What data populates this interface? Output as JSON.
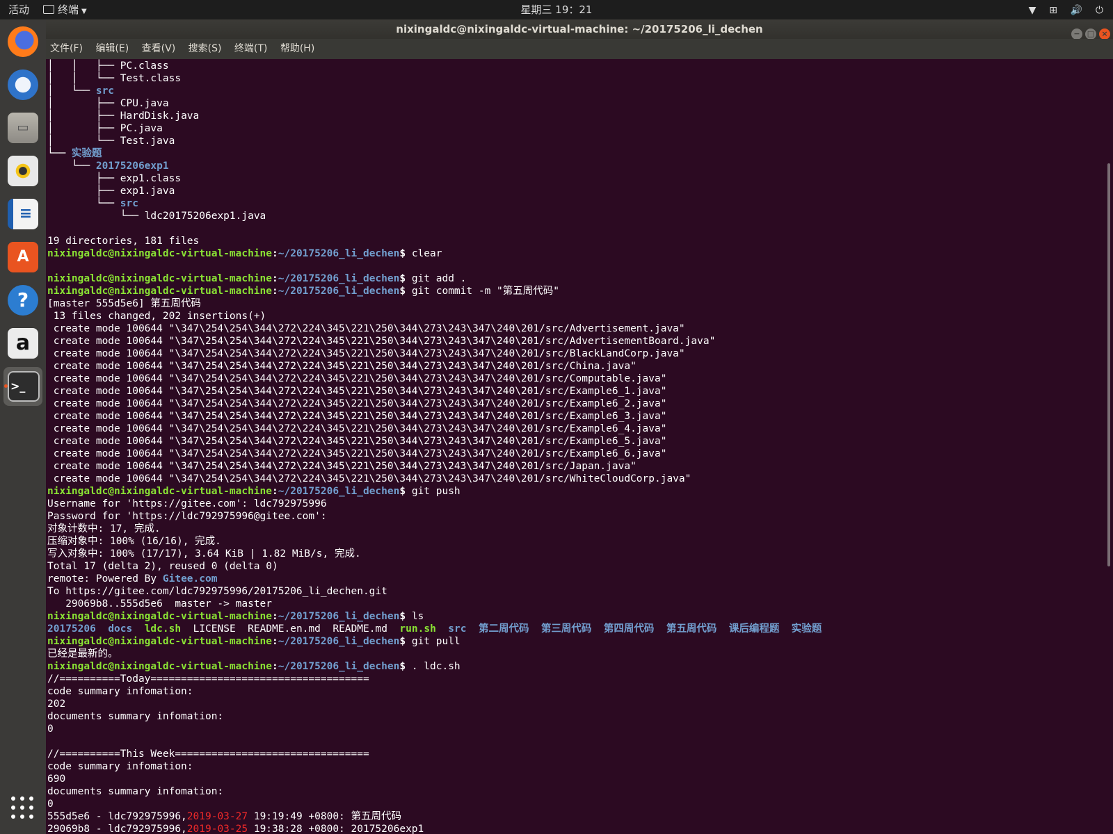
{
  "topbar": {
    "activities": "活动",
    "app_name": "终端",
    "clock": "星期三 19：21",
    "icons": [
      "chevron-down-icon",
      "network-icon",
      "volume-icon",
      "power-icon"
    ]
  },
  "dock": {
    "apps": [
      "firefox-icon",
      "thunderbird-icon",
      "files-icon",
      "rhythmbox-icon",
      "libreoffice-writer-icon",
      "software-center-icon",
      "help-icon",
      "amazon-icon",
      "terminal-icon"
    ]
  },
  "window": {
    "title": "nixingaldc@nixingaldc-virtual-machine: ~/20175206_li_dechen",
    "menus": [
      "文件(F)",
      "编辑(E)",
      "查看(V)",
      "搜索(S)",
      "终端(T)",
      "帮助(H)"
    ]
  },
  "prompt": {
    "user": "nixingaldc@nixingaldc-virtual-machine",
    "path": "~/20175206_li_dechen",
    "sep": ":",
    "dollar": "$"
  },
  "terminal": {
    "tree": [
      {
        "prefix": "│   │   ├── ",
        "name": "PC.class",
        "type": "file"
      },
      {
        "prefix": "│   │   └── ",
        "name": "Test.class",
        "type": "file"
      },
      {
        "prefix": "│   └── ",
        "name": "src",
        "type": "dir"
      },
      {
        "prefix": "│       ├── ",
        "name": "CPU.java",
        "type": "file"
      },
      {
        "prefix": "│       ├── ",
        "name": "HardDisk.java",
        "type": "file"
      },
      {
        "prefix": "│       ├── ",
        "name": "PC.java",
        "type": "file"
      },
      {
        "prefix": "│       └── ",
        "name": "Test.java",
        "type": "file"
      },
      {
        "prefix": "└── ",
        "name": "实验题",
        "type": "dir"
      },
      {
        "prefix": "    └── ",
        "name": "20175206exp1",
        "type": "dir"
      },
      {
        "prefix": "        ├── ",
        "name": "exp1.class",
        "type": "file"
      },
      {
        "prefix": "        ├── ",
        "name": "exp1.java",
        "type": "file"
      },
      {
        "prefix": "        └── ",
        "name": "src",
        "type": "dir"
      },
      {
        "prefix": "            └── ",
        "name": "ldc20175206exp1.java",
        "type": "file"
      }
    ],
    "tree_summary": "19 directories, 181 files",
    "cmd_clear": "clear",
    "cmd_add": "git add .",
    "cmd_commit": "git commit -m \"第五周代码\"",
    "commit_header": "[master 555d5e6] 第五周代码",
    "commit_stats": " 13 files changed, 202 insertions(+)",
    "create_prefix": " create mode 100644 \"\\347\\254\\254\\344\\272\\224\\345\\221\\250\\344\\273\\243\\347\\240\\201/src/",
    "created_files": [
      "Advertisement.java",
      "AdvertisementBoard.java",
      "BlackLandCorp.java",
      "China.java",
      "Computable.java",
      "Example6_1.java",
      "Example6_2.java",
      "Example6_3.java",
      "Example6_4.java",
      "Example6_5.java",
      "Example6_6.java",
      "Japan.java",
      "WhiteCloudCorp.java"
    ],
    "cmd_push": "git push",
    "push_output": [
      "Username for 'https://gitee.com': ldc792975996",
      "Password for 'https://ldc792975996@gitee.com':",
      "对象计数中: 17, 完成.",
      "压缩对象中: 100% (16/16), 完成.",
      "写入对象中: 100% (17/17), 3.64 KiB | 1.82 MiB/s, 完成.",
      "Total 17 (delta 2), reused 0 (delta 0)"
    ],
    "remote_prefix": "remote: Powered By ",
    "remote_link": "Gitee.com",
    "push_to": "To https://gitee.com/ldc792975996/20175206_li_dechen.git",
    "push_refs": "   29069b8..555d5e6  master -> master",
    "cmd_ls": "ls",
    "ls_items": [
      {
        "name": "20175206",
        "color": "blue"
      },
      {
        "name": "docs",
        "color": "blue"
      },
      {
        "name": "ldc.sh",
        "color": "green"
      },
      {
        "name": "LICENSE",
        "color": "white"
      },
      {
        "name": "README.en.md",
        "color": "white"
      },
      {
        "name": "README.md",
        "color": "white"
      },
      {
        "name": "run.sh",
        "color": "green"
      },
      {
        "name": "src",
        "color": "blue"
      },
      {
        "name": "第二周代码",
        "color": "blue"
      },
      {
        "name": "第三周代码",
        "color": "blue"
      },
      {
        "name": "第四周代码",
        "color": "blue"
      },
      {
        "name": "第五周代码",
        "color": "blue"
      },
      {
        "name": "课后编程题",
        "color": "blue"
      },
      {
        "name": "实验题",
        "color": "blue"
      }
    ],
    "cmd_pull": "git pull",
    "pull_output": "已经是最新的。",
    "cmd_ldc": ". ldc.sh",
    "ldc_output": [
      "//==========Today====================================",
      "code summary infomation:",
      "202",
      "documents summary infomation:",
      "0",
      "",
      "//==========This Week================================",
      "code summary infomation:",
      "690",
      "documents summary infomation:",
      "0"
    ],
    "log_entries": [
      {
        "hash_author": "555d5e6 - ldc792975996,",
        "date": "2019-03-27",
        "rest": " 19:19:49 +0800: 第五周代码"
      },
      {
        "hash_author": "29069b8 - ldc792975996,",
        "date": "2019-03-25",
        "rest": " 19:38:28 +0800: 20175206exp1"
      }
    ]
  },
  "colors": {
    "terminal_bg": "#2c0a22",
    "prompt_user": "#8ae234",
    "prompt_path": "#729fcf",
    "date": "#ef2929",
    "accent": "#e95420"
  }
}
